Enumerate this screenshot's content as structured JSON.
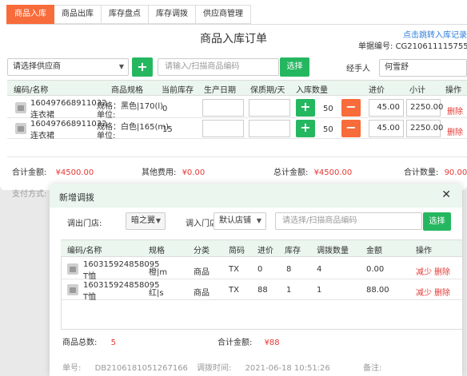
{
  "tabs": [
    "商品入库",
    "商品出库",
    "库存盘点",
    "库存调拨",
    "供应商管理"
  ],
  "page_title": "商品入库订单",
  "jump_link": "点击跳转入库记录",
  "order_no_label": "单据编号:",
  "order_no": "CG210611115755456",
  "supplier_select": "请选择供应商",
  "scan_placeholder": "请输入/扫描商品编码",
  "select_btn": "选择",
  "handler_label": "经手人",
  "handler_value": "何雪舒",
  "table_headers": [
    "编码/名称",
    "商品规格",
    "当前库存",
    "生产日期",
    "保质期/天",
    "入库数量",
    "进价",
    "小计",
    "操作"
  ],
  "rows": [
    {
      "code": "160497668911032",
      "name": "连衣裙",
      "spec": "规格：黑色|170(l)",
      "unit": "单位:",
      "stock": "0",
      "qty": "50",
      "price": "45.00",
      "subtotal": "2250.00",
      "op": "删除"
    },
    {
      "code": "160497668911032",
      "name": "连衣裙",
      "spec": "规格：白色|165(m)",
      "unit": "单位:",
      "stock": "15",
      "qty": "50",
      "price": "45.00",
      "subtotal": "2250.00",
      "op": "删除"
    }
  ],
  "summary": {
    "total_label": "合计金额:",
    "total_value": "¥4500.00",
    "other_label": "其他费用:",
    "other_value": "¥0.00",
    "grand_label": "总计金额:",
    "grand_value": "¥4500.00",
    "count_label": "合计数量:",
    "count_value": "90.00"
  },
  "payment_label": "支付方式:",
  "modal": {
    "title": "新增调拨",
    "close": "✕",
    "out_store_label": "调出门店:",
    "out_store_value": "暗之翼",
    "in_store_label": "调入门店:",
    "in_store_value": "默认店铺",
    "scan_placeholder": "请选择/扫描商品编码",
    "select_btn": "选择",
    "headers": [
      "编码/名称",
      "规格",
      "分类",
      "简码",
      "进价",
      "库存",
      "调拨数量",
      "金额",
      "操作"
    ],
    "rows": [
      {
        "code": "160315924858095",
        "name": "T恤",
        "spec": "橙|m",
        "category": "商品",
        "short": "TX",
        "price": "0",
        "stock": "8",
        "qty": "4",
        "amount": "0.00",
        "op1": "减少",
        "op2": "删除"
      },
      {
        "code": "160315924858095",
        "name": "T恤",
        "spec": "红|s",
        "category": "商品",
        "short": "TX",
        "price": "88",
        "stock": "1",
        "qty": "1",
        "amount": "88.00",
        "op1": "减少",
        "op2": "删除"
      }
    ],
    "total_count_label": "商品总数:",
    "total_count_value": "5",
    "total_amount_label": "合计金额:",
    "total_amount_value": "¥88",
    "doc_no_label": "单号:",
    "doc_no_value": "DB2106181051267166",
    "time_label": "调拨时间:",
    "time_value": "2021-06-18 10:51:26",
    "remark_label": "备注:"
  },
  "colors": {
    "accent": "#f86b3a",
    "green": "#25b760",
    "red": "#e53935",
    "header_bg": "#eaf6ee",
    "link": "#2f7fd8"
  }
}
